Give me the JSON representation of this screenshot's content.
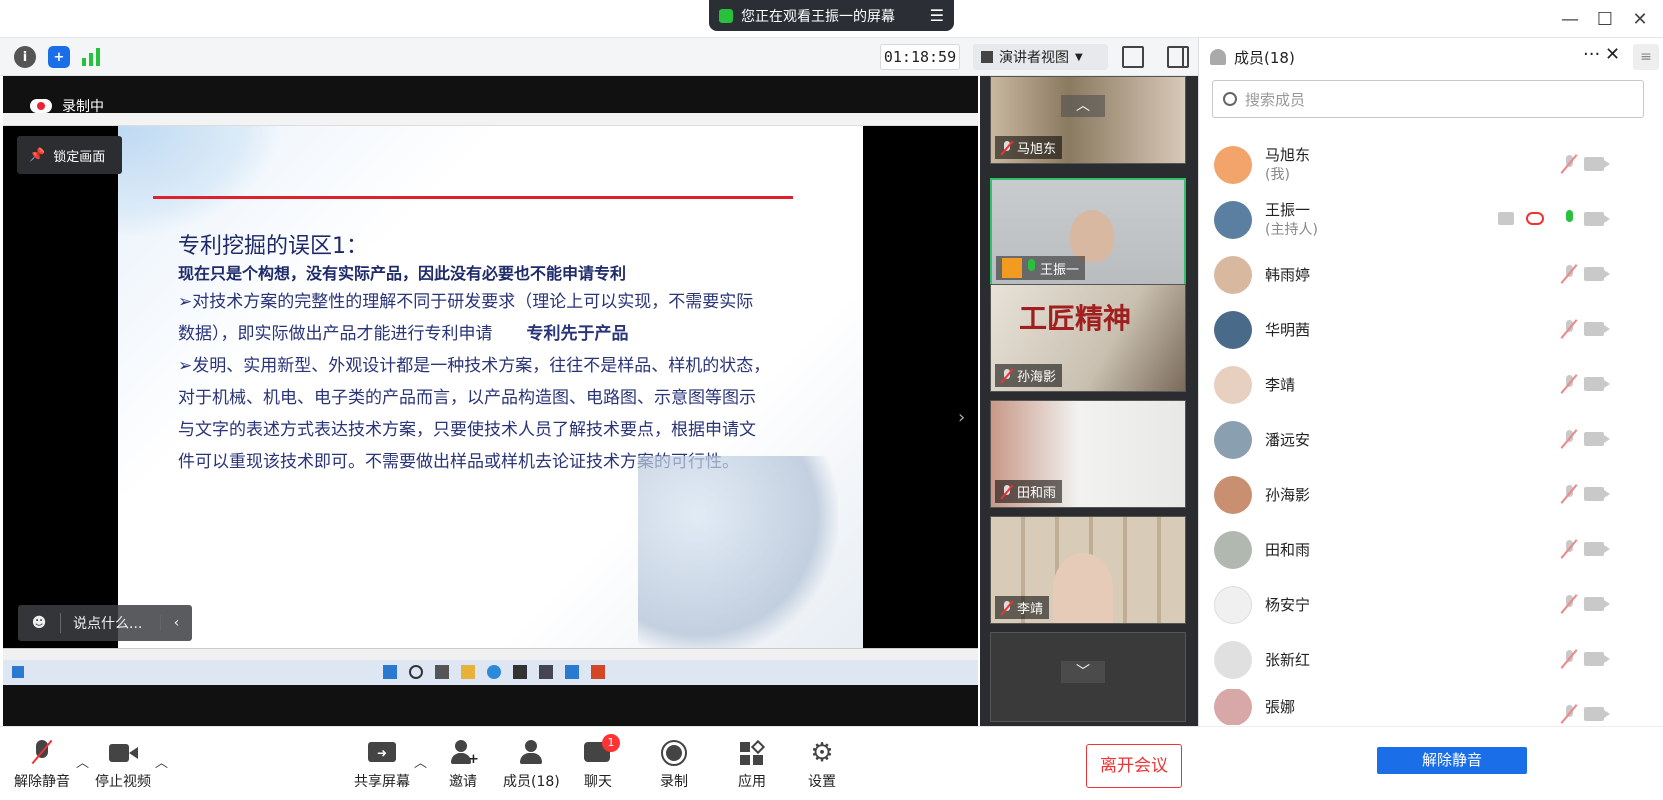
{
  "titlebar": {
    "share_notice": "您正在观看王振一的屏幕",
    "menu_icon": "list-icon"
  },
  "toolbar": {
    "timer": "01:18:59",
    "view_mode": "演讲者视图"
  },
  "main": {
    "recording_label": "录制中",
    "lock_label": "锁定画面",
    "chat_placeholder": "说点什么...",
    "slide": {
      "heading": "专利挖掘的误区1：",
      "subheading": "现在只是个构想，没有实际产品，因此没有必要也不能申请专利",
      "para1a": "➢对技术方案的完整性的理解不同于研发要求（理论上可以实现，不需要实际",
      "para1b": "数据），即实际做出产品才能进行专利申请",
      "para1emph": "专利先于产品",
      "para2a": "➢发明、实用新型、外观设计都是一种技术方案，往往不是样品、样机的状态，",
      "para2b": "对于机械、机电、电子类的产品而言，以产品构造图、电路图、示意图等图示",
      "para2c": "与文字的表述方式表达技术方案，只要使技术人员了解技术要点，根据申请文",
      "para2d": "件可以重现该技术即可。不需要做出样品或样机去论证技术方案的可行性。"
    }
  },
  "strip": {
    "tiles": [
      {
        "name": "马旭东"
      },
      {
        "name": "王振一"
      },
      {
        "name": "孙海影"
      },
      {
        "name": "田和雨"
      },
      {
        "name": "李靖"
      }
    ]
  },
  "panel": {
    "title": "成员(18)",
    "search_placeholder": "搜索成员",
    "members": [
      {
        "name": "马旭东",
        "sub": "(我)",
        "color": "#f3a46a"
      },
      {
        "name": "王振一",
        "sub": "(主持人)",
        "color": "#5a7fa0"
      },
      {
        "name": "韩雨婷",
        "sub": "",
        "color": "#d9b8a0"
      },
      {
        "name": "华明茜",
        "sub": "",
        "color": "#4a6a8a"
      },
      {
        "name": "李靖",
        "sub": "",
        "color": "#e8d0c0"
      },
      {
        "name": "潘远安",
        "sub": "",
        "color": "#8aa0b0"
      },
      {
        "name": "孙海影",
        "sub": "",
        "color": "#c89070"
      },
      {
        "name": "田和雨",
        "sub": "",
        "color": "#b0b8b0"
      },
      {
        "name": "杨安宁",
        "sub": "",
        "color": "#f0f0f0"
      },
      {
        "name": "张新红",
        "sub": "",
        "color": "#e0e0e0"
      },
      {
        "name": "張娜",
        "sub": "",
        "color": "#d8a8a8"
      }
    ],
    "unmute_all": "解除静音"
  },
  "bottom": {
    "unmute": "解除静音",
    "stop_video": "停止视频",
    "share": "共享屏幕",
    "invite": "邀请",
    "members": "成员(18)",
    "chat": "聊天",
    "chat_badge": "1",
    "record": "录制",
    "apps": "应用",
    "settings": "设置",
    "leave": "离开会议"
  }
}
